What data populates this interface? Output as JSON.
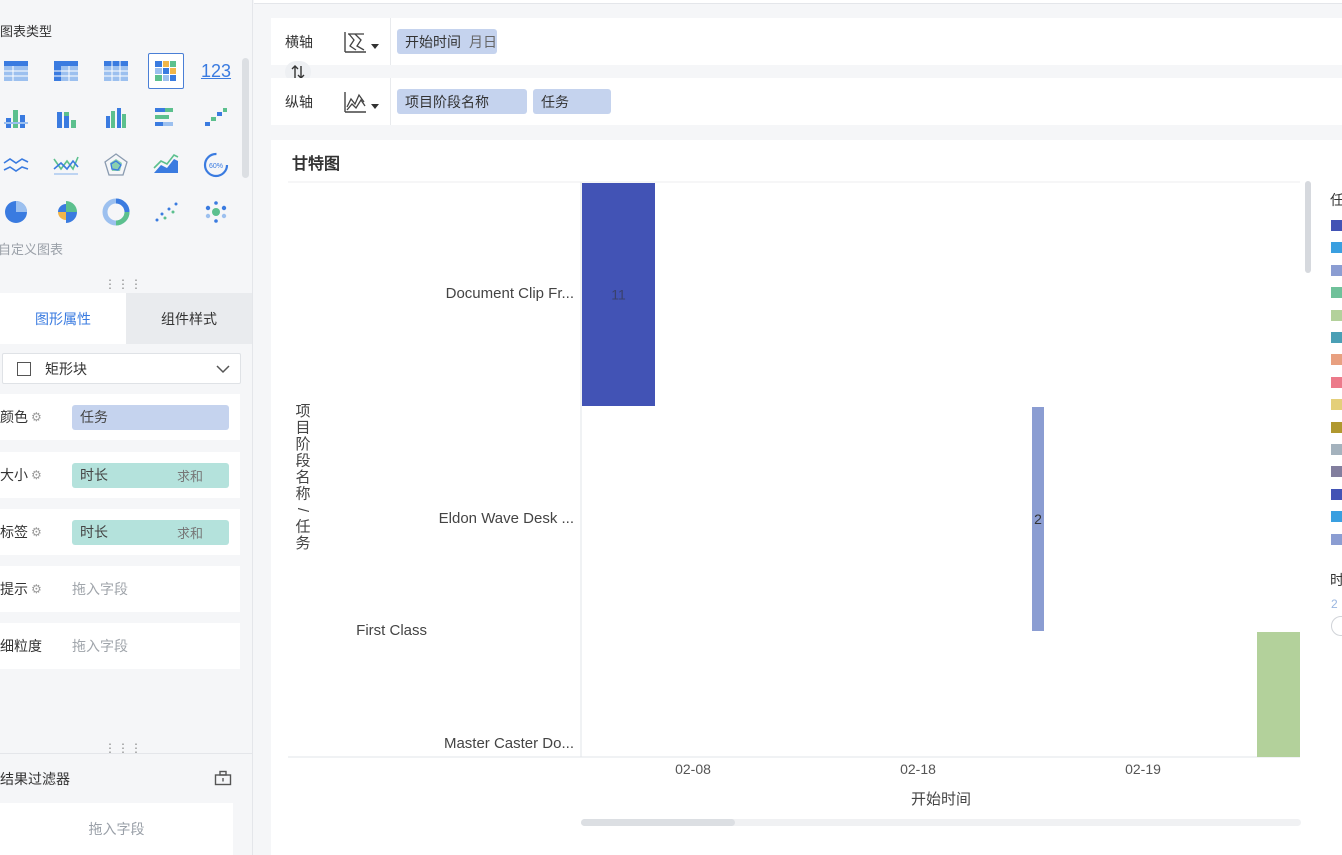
{
  "left_panel": {
    "chart_types_title": "图表类型",
    "custom_chart": "自定义图表",
    "chart_icons": [
      "table-icon",
      "cross-table-icon",
      "detail-table-icon",
      "heatmap-table-icon",
      "kpi-number-icon",
      "grouped-bar-icon",
      "stacked-bar-icon",
      "multi-bar-icon",
      "horizontal-bar-icon",
      "waterfall-icon",
      "line-icon",
      "polyline-icon",
      "radar-icon",
      "area-icon",
      "gauge-icon",
      "pie-icon",
      "rose-pie-icon",
      "donut-icon",
      "scatter-icon",
      "bubble-icon"
    ],
    "gauge_text": "60%",
    "kpi_text": "123",
    "tabs": {
      "graphic_props": "图形属性",
      "component_style": "组件样式"
    },
    "mark_type": "矩形块",
    "props": {
      "color_label": "颜色",
      "color_field": "任务",
      "size_label": "大小",
      "size_field": "时长",
      "size_agg": "求和",
      "label_label": "标签",
      "label_field": "时长",
      "label_agg": "求和",
      "tooltip_label": "提示",
      "tooltip_placeholder": "拖入字段",
      "granularity_label": "细粒度",
      "granularity_placeholder": "拖入字段"
    },
    "result_filter": "结果过滤器",
    "filter_placeholder": "拖入字段"
  },
  "axes": {
    "x_label": "横轴",
    "x_field": "开始时间",
    "x_field_sub": "月日",
    "y_label": "纵轴",
    "y_fields": [
      "项目阶段名称",
      "任务"
    ]
  },
  "chart": {
    "title": "甘特图",
    "legend_title": "任",
    "size_legend_title": "时",
    "size_legend_value": "2"
  },
  "chart_data": {
    "type": "bar",
    "title": "甘特图",
    "xlabel": "开始时间",
    "ylabel": "项目阶段名称/任务",
    "x_ticks": [
      "02-08",
      "02-18",
      "02-19"
    ],
    "categories": [
      "Document Clip Fr...",
      "Eldon Wave Desk ...",
      "First Class",
      "Master Caster Do..."
    ],
    "bars": [
      {
        "category": "Document Clip Fr...",
        "start": "02-08",
        "value": 11,
        "color": "#4253b5"
      },
      {
        "category": "Eldon Wave Desk ...",
        "start": "02-18",
        "value": 2,
        "color": "#8b9dd2"
      },
      {
        "category": "Master Caster Do...",
        "start": "02-19",
        "value": null,
        "color": "#b3d19b"
      }
    ],
    "legend_colors": [
      "#4253b5",
      "#3a9fe0",
      "#8b9dd2",
      "#6fc19a",
      "#b3d19b",
      "#4a9fb5",
      "#e8a080",
      "#ec7a8a",
      "#e4cf7a",
      "#b0982f",
      "#a4b2bd",
      "#827e9e",
      "#4253b5",
      "#3a9fe0",
      "#8b9dd2"
    ],
    "grid": false
  }
}
